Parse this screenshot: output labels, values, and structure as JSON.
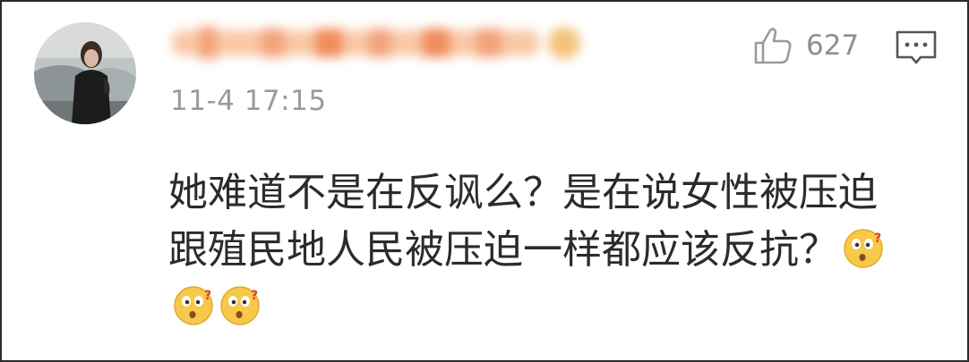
{
  "comment": {
    "timestamp": "11-4 17:15",
    "like_count": "627",
    "text": "她难道不是在反讽么？是在说女性被压迫跟殖民地人民被压迫一样都应该反抗？",
    "emojis": [
      "confused-face-emoji",
      "confused-face-emoji",
      "confused-face-emoji"
    ]
  },
  "icons": {
    "like": "thumbs-up-icon",
    "reply": "comment-bubble-icon"
  },
  "colors": {
    "text": "#2b2b2b",
    "meta": "#9a9a9a",
    "username_blur": "#f7b98c"
  }
}
